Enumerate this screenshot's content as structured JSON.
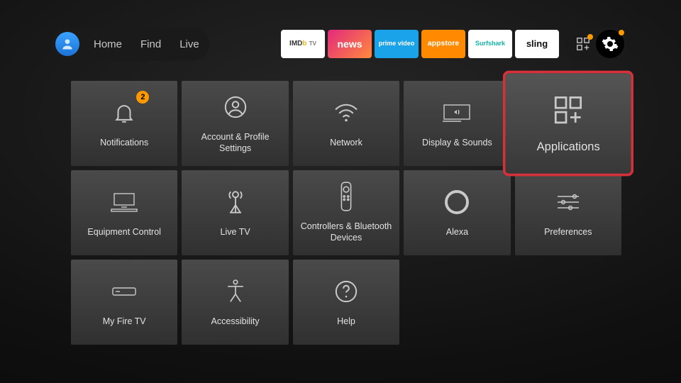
{
  "nav": {
    "home": "Home",
    "find": "Find",
    "live": "Live"
  },
  "apps": {
    "imdb": "IMDb TV",
    "news": "news",
    "prime": "prime video",
    "store": "appstore",
    "surf": "Surfshark",
    "sling": "sling"
  },
  "notification_badge": "2",
  "tiles": {
    "notifications": "Notifications",
    "account": "Account & Profile Settings",
    "network": "Network",
    "display": "Display & Sounds",
    "applications": "Applications",
    "equipment": "Equipment Control",
    "livetv": "Live TV",
    "controllers": "Controllers & Bluetooth Devices",
    "alexa": "Alexa",
    "preferences": "Preferences",
    "myfiretv": "My Fire TV",
    "accessibility": "Accessibility",
    "help": "Help"
  },
  "selected_tile": "applications"
}
